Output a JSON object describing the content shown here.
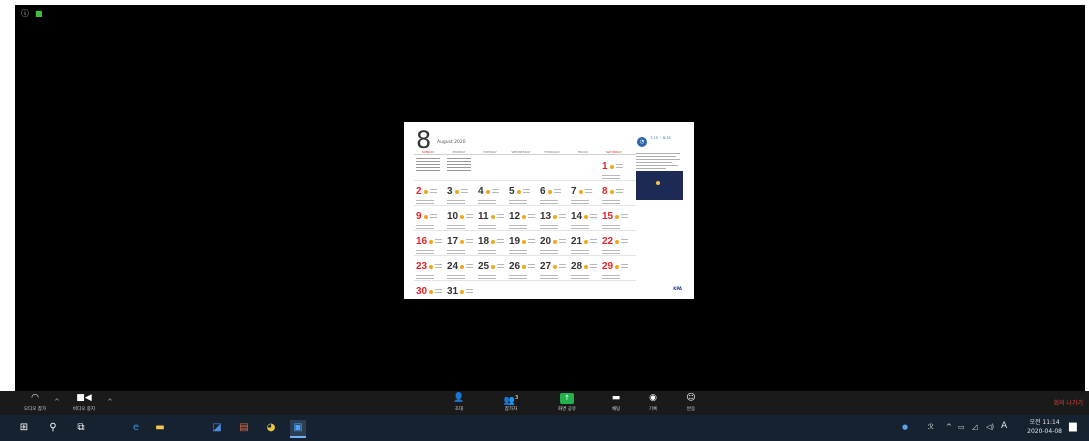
{
  "shared_calendar": {
    "month_number": "8",
    "month_label": "August 2020",
    "weekdays": [
      "SUNDAY",
      "MONDAY",
      "TUESDAY",
      "WEDNESDAY",
      "THURSDAY",
      "FRIDAY",
      "SATURDAY"
    ],
    "weeks": [
      [
        {
          "d": "",
          "red": false
        },
        {
          "d": "",
          "red": false
        },
        {
          "d": "",
          "red": false
        },
        {
          "d": "",
          "red": false
        },
        {
          "d": "",
          "red": false
        },
        {
          "d": "",
          "red": false
        },
        {
          "d": "1",
          "red": true
        }
      ],
      [
        {
          "d": "2",
          "red": true
        },
        {
          "d": "3",
          "red": false
        },
        {
          "d": "4",
          "red": false
        },
        {
          "d": "5",
          "red": false
        },
        {
          "d": "6",
          "red": false
        },
        {
          "d": "7",
          "red": false
        },
        {
          "d": "8",
          "red": true
        }
      ],
      [
        {
          "d": "9",
          "red": true
        },
        {
          "d": "10",
          "red": false
        },
        {
          "d": "11",
          "red": false
        },
        {
          "d": "12",
          "red": false
        },
        {
          "d": "13",
          "red": false
        },
        {
          "d": "14",
          "red": false
        },
        {
          "d": "15",
          "red": true
        }
      ],
      [
        {
          "d": "16",
          "red": true
        },
        {
          "d": "17",
          "red": false
        },
        {
          "d": "18",
          "red": false
        },
        {
          "d": "19",
          "red": false
        },
        {
          "d": "20",
          "red": false
        },
        {
          "d": "21",
          "red": false
        },
        {
          "d": "22",
          "red": true
        }
      ],
      [
        {
          "d": "23",
          "red": true
        },
        {
          "d": "24",
          "red": false
        },
        {
          "d": "25",
          "red": false
        },
        {
          "d": "26",
          "red": false
        },
        {
          "d": "27",
          "red": false
        },
        {
          "d": "28",
          "red": false
        },
        {
          "d": "29",
          "red": true
        }
      ],
      [
        {
          "d": "30",
          "red": true
        },
        {
          "d": "31",
          "red": false
        },
        {
          "d": "",
          "red": false
        },
        {
          "d": "",
          "red": false
        },
        {
          "d": "",
          "red": false
        },
        {
          "d": "",
          "red": false
        },
        {
          "d": "",
          "red": false
        }
      ]
    ],
    "side_time": "7:15 ~ 8:35",
    "footer_logo": "KPA"
  },
  "meeting_toolbar": {
    "audio_label": "오디오 참가",
    "video_label": "비디오 중지",
    "invite_label": "초대",
    "participants_label": "참가자",
    "participants_count": "3",
    "share_label": "화면 공유",
    "chat_label": "채팅",
    "record_label": "기록",
    "reactions_label": "반응",
    "leave_label": "회의 나가기"
  },
  "taskbar": {
    "ime": "A",
    "clock_ampm_time": "오전 11:14",
    "clock_date": "2020-04-08"
  },
  "colors": {
    "accent_red": "#e0242a",
    "share_green": "#22b14c",
    "leave_red": "#e0453b"
  }
}
